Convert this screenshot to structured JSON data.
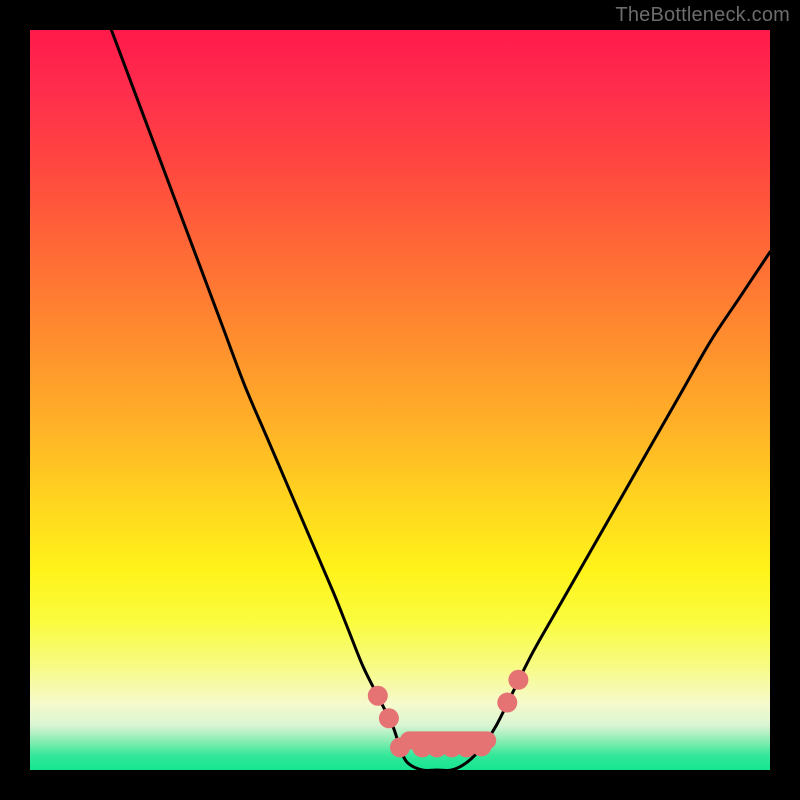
{
  "watermark": "TheBottleneck.com",
  "chart_data": {
    "type": "line",
    "title": "",
    "xlabel": "",
    "ylabel": "",
    "xlim": [
      0,
      100
    ],
    "ylim": [
      0,
      100
    ],
    "series": [
      {
        "name": "curve",
        "x": [
          11,
          14,
          17,
          20,
          23,
          26,
          29,
          32,
          35,
          38,
          41,
          43,
          45,
          47,
          49,
          50,
          51,
          53,
          55,
          57,
          59,
          61,
          63,
          65,
          68,
          72,
          76,
          80,
          84,
          88,
          92,
          96,
          100
        ],
        "y": [
          100,
          92,
          84,
          76,
          68,
          60,
          52,
          45,
          38,
          31,
          24,
          19,
          14,
          10,
          6,
          3,
          1,
          0,
          0,
          0,
          1,
          3,
          6,
          10,
          16,
          23,
          30,
          37,
          44,
          51,
          58,
          64,
          70
        ]
      }
    ],
    "flat_zone": {
      "start_x": 50,
      "end_x": 63,
      "y": 4,
      "marker_xs": [
        47,
        48.5,
        50,
        53,
        55,
        57,
        59,
        61,
        64.5,
        66
      ]
    },
    "background_gradient_stops": [
      {
        "pos": 0,
        "color": "#ff1a4b"
      },
      {
        "pos": 50,
        "color": "#ffb327"
      },
      {
        "pos": 80,
        "color": "#fafc3f"
      },
      {
        "pos": 100,
        "color": "#14e58f"
      }
    ]
  }
}
